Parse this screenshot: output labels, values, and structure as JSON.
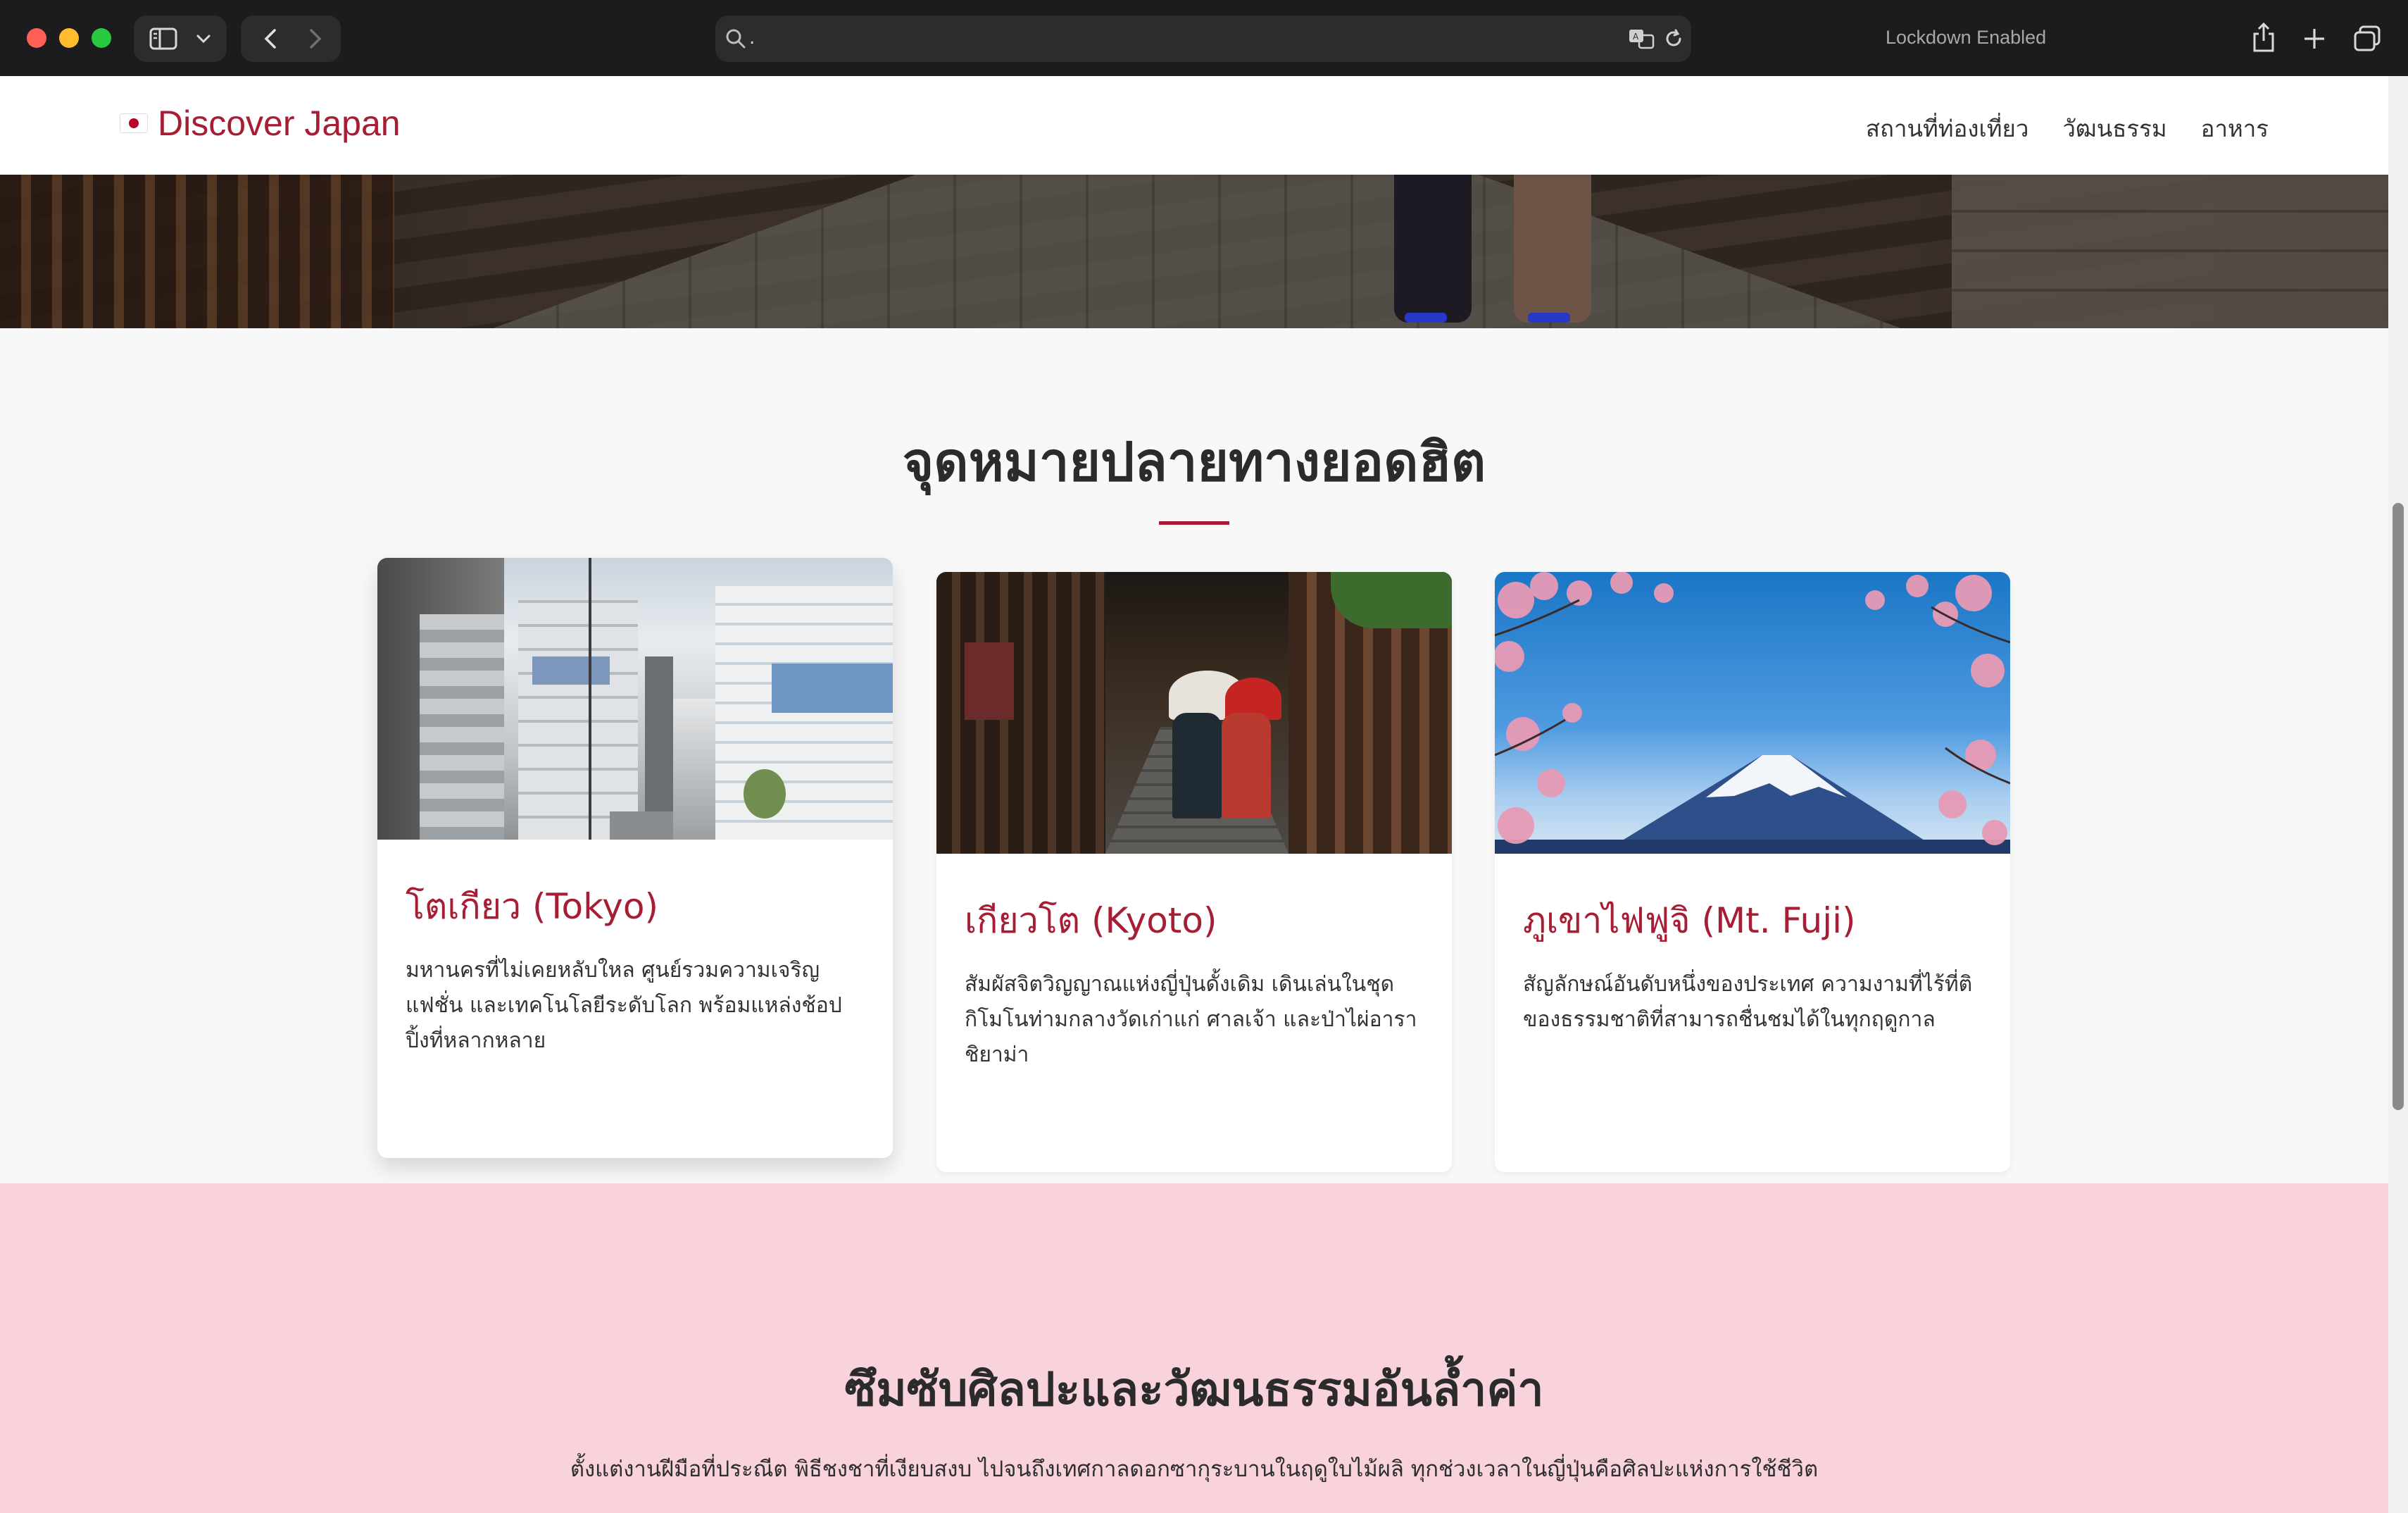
{
  "browser": {
    "address_text": ".",
    "lockdown_label": "Lockdown Enabled"
  },
  "site": {
    "logo_text": "Discover Japan",
    "nav": [
      "สถานที่ท่องเที่ยว",
      "วัฒนธรรม",
      "อาหาร"
    ]
  },
  "destinations": {
    "title": "จุดหมายปลายทางยอดฮิต",
    "cards": [
      {
        "title": "โตเกียว (Tokyo)",
        "description": "มหานครที่ไม่เคยหลับใหล ศูนย์รวมความเจริญ แฟชั่น และเทคโนโลยีระดับโลก พร้อมแหล่งช้อปปิ้งที่หลากหลาย"
      },
      {
        "title": "เกียวโต (Kyoto)",
        "description": "สัมผัสจิตวิญญาณแห่งญี่ปุ่นดั้งเดิม เดินเล่นในชุดกิโมโนท่ามกลางวัดเก่าแก่ ศาลเจ้า และป่าไผ่อาราชิยาม่า"
      },
      {
        "title": "ภูเขาไฟฟูจิ (Mt. Fuji)",
        "description": "สัญลักษณ์อันดับหนึ่งของประเทศ ความงามที่ไร้ที่ติของธรรมชาติที่สามารถชื่นชมได้ในทุกฤดูกาล"
      }
    ]
  },
  "culture": {
    "title": "ซึมซับศิลปะและวัฒนธรรมอันล้ำค่า",
    "text": "ตั้งแต่งานฝีมือที่ประณีต พิธีชงชาที่เงียบสงบ ไปจนถึงเทศกาลดอกซากุระบานในฤดูใบไม้ผลิ ทุกช่วงเวลาในญี่ปุ่นคือศิลปะแห่งการใช้ชีวิต"
  },
  "colors": {
    "accent": "#a61d34",
    "culture_bg": "#f8d3dc",
    "page_bg": "#f8f8f8"
  }
}
